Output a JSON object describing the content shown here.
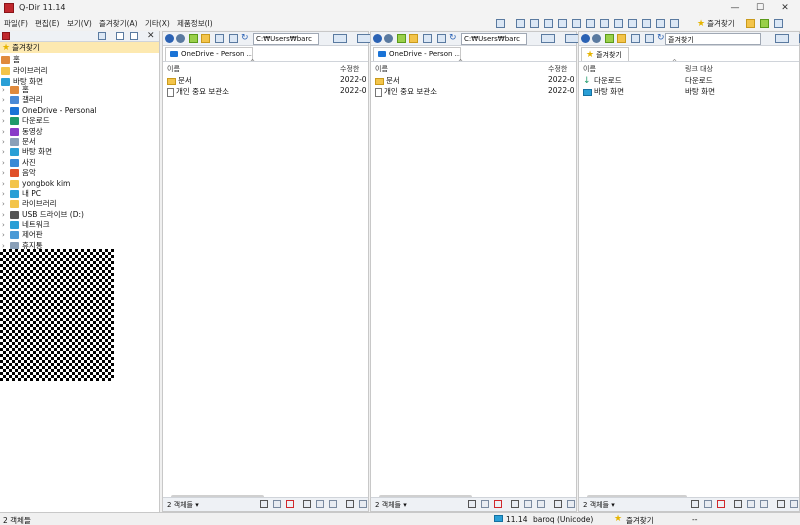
{
  "window": {
    "title": "Q-Dir 11.14"
  },
  "menu": [
    "파일(F)",
    "편집(E)",
    "보기(V)",
    "즐겨찾기(A)",
    "기타(X)",
    "제품정보(I)"
  ],
  "menu_right": {
    "favorites_label": "즐겨찾기"
  },
  "left_pane": {
    "favorites_header": "즐겨찾기",
    "top_items": [
      "홈",
      "라이브러리",
      "바탕 화면"
    ],
    "tree_items": [
      {
        "label": "홈",
        "icon": "home-icon",
        "color": "#e08a3c"
      },
      {
        "label": "갤러리",
        "icon": "gallery-icon",
        "color": "#4a8ad6"
      },
      {
        "label": "OneDrive - Personal",
        "icon": "cloud-icon",
        "color": "#1a73d6"
      },
      {
        "label": "다운로드",
        "icon": "download-icon",
        "color": "#1f9a6a"
      },
      {
        "label": "동영상",
        "icon": "video-icon",
        "color": "#8a3cc8"
      },
      {
        "label": "문서",
        "icon": "document-icon",
        "color": "#8aa0b8"
      },
      {
        "label": "바탕 화면",
        "icon": "desktop-icon",
        "color": "#2a9fd6"
      },
      {
        "label": "사진",
        "icon": "photo-icon",
        "color": "#3a8ad6"
      },
      {
        "label": "음악",
        "icon": "music-icon",
        "color": "#e0502a"
      },
      {
        "label": "yongbok kim",
        "icon": "folder-icon",
        "color": "#f3c44a"
      },
      {
        "label": "내 PC",
        "icon": "pc-icon",
        "color": "#2a9fd6"
      },
      {
        "label": "라이브러리",
        "icon": "library-icon",
        "color": "#f3c44a"
      },
      {
        "label": "USB 드라이브 (D:)",
        "icon": "usb-drive-icon",
        "color": "#555555"
      },
      {
        "label": "네트워크",
        "icon": "network-icon",
        "color": "#2a9fd6"
      },
      {
        "label": "제어판",
        "icon": "control-panel-icon",
        "color": "#4a9ad6"
      },
      {
        "label": "휴지통",
        "icon": "recycle-bin-icon",
        "color": "#8aa0b8"
      }
    ]
  },
  "panes": [
    {
      "address": "C:₩Users₩barc",
      "tab": "OneDrive - Person ...",
      "col_name": "이름",
      "col_second": "수정한",
      "rows": [
        {
          "name": "문서",
          "icon": "folder-icon",
          "value": "2022-0"
        },
        {
          "name": "개인 중요 보관소",
          "icon": "document-icon",
          "value": "2022-0"
        }
      ],
      "status": "2 객체들"
    },
    {
      "address": "C:₩Users₩barc",
      "tab": "OneDrive - Person ...",
      "col_name": "이름",
      "col_second": "수정한",
      "rows": [
        {
          "name": "문서",
          "icon": "folder-icon",
          "value": "2022-0"
        },
        {
          "name": "개인 중요 보관소",
          "icon": "document-icon",
          "value": "2022-0"
        }
      ],
      "status": "2 객체들"
    },
    {
      "address": "즐겨찾기",
      "tab": "즐겨찾기",
      "col_name": "이름",
      "col_second": "링크 대상",
      "rows": [
        {
          "name": "다운로드",
          "icon": "download-icon",
          "value": "다운로드"
        },
        {
          "name": "바탕 화면",
          "icon": "desktop-icon",
          "value": "바탕 화면"
        }
      ],
      "status": "2 객체들"
    }
  ],
  "statusbar": {
    "left": "2 객체들",
    "version": "11.14",
    "user": "baroq (Unicode)",
    "location": "즐겨찾기",
    "tail": "--"
  },
  "colors": {
    "accent": "#2b62b4",
    "brand": "#c0282d"
  }
}
